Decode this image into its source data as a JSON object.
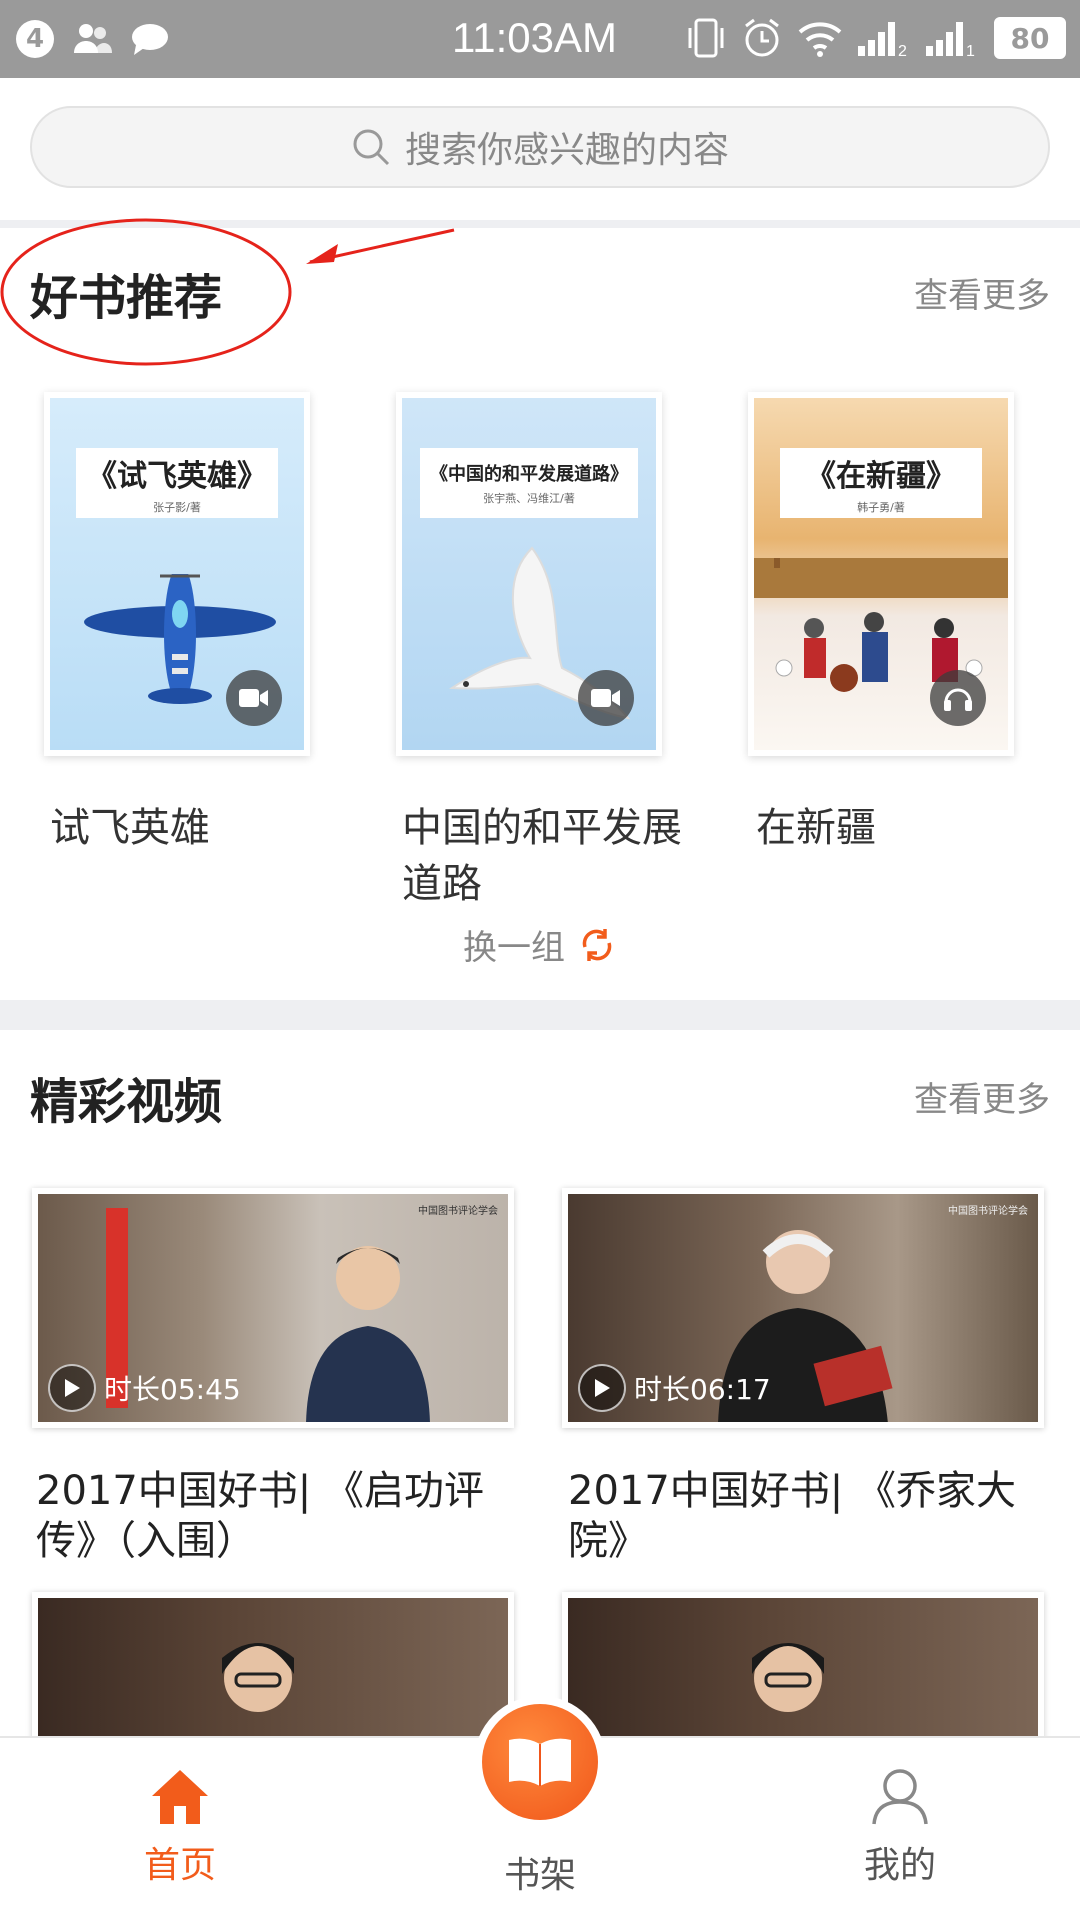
{
  "status_bar": {
    "notif_count": "4",
    "time": "11:03AM",
    "battery": "80",
    "sim1": "2",
    "sim2": "1"
  },
  "search": {
    "placeholder": "搜索你感兴趣的内容"
  },
  "recommend": {
    "title": "好书推荐",
    "more": "查看更多",
    "books": [
      {
        "name": "试飞英雄",
        "cover_title": "《试飞英雄》",
        "cover_author": "张子影/著",
        "media": "video-icon"
      },
      {
        "name": "中国的和平发展道路",
        "cover_title": "《中国的和平发展道路》",
        "cover_author": "张宇燕、冯维江/著",
        "media": "video-icon"
      },
      {
        "name": "在新疆",
        "cover_title": "《在新疆》",
        "cover_author": "韩子勇/著",
        "media": "headphones-icon"
      }
    ],
    "refresh": "换一组"
  },
  "videos": {
    "title": "精彩视频",
    "more": "查看更多",
    "items": [
      {
        "duration": "时长05:45",
        "title": "2017中国好书| 《启功评传》（入围）",
        "logo_text": "中国图书评论学会"
      },
      {
        "duration": "时长06:17",
        "title": "2017中国好书| 《乔家大院》",
        "logo_text": "中国图书评论学会"
      }
    ]
  },
  "tabbar": {
    "home": "首页",
    "shelf": "书架",
    "mine": "我的"
  },
  "colors": {
    "accent": "#f25c1b",
    "annotation": "#e5231b"
  }
}
